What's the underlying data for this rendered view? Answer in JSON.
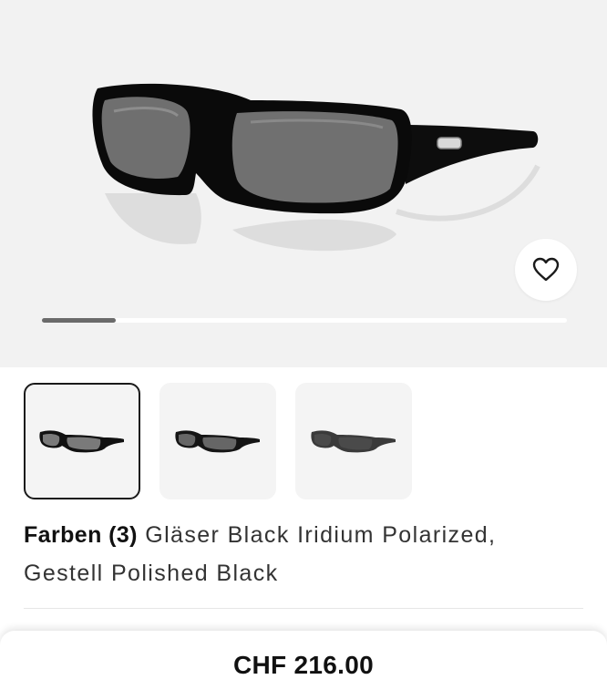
{
  "product": {
    "image_icon": "sunglasses-product-image",
    "favorite_icon": "heart-outline-icon",
    "gallery_progress": 0.14
  },
  "colors": {
    "label": "Farben (3)",
    "description_line1": "Gläser Black Iridium Polarized,",
    "description_line2": "Gestell Polished Black",
    "swatches": [
      {
        "icon": "sunglasses-polished-black-thumbnail",
        "selected": true
      },
      {
        "icon": "sunglasses-variant-2-thumbnail",
        "selected": false
      },
      {
        "icon": "sunglasses-variant-3-thumbnail",
        "selected": false
      }
    ]
  },
  "price_bar": {
    "price": "CHF 216.00"
  }
}
